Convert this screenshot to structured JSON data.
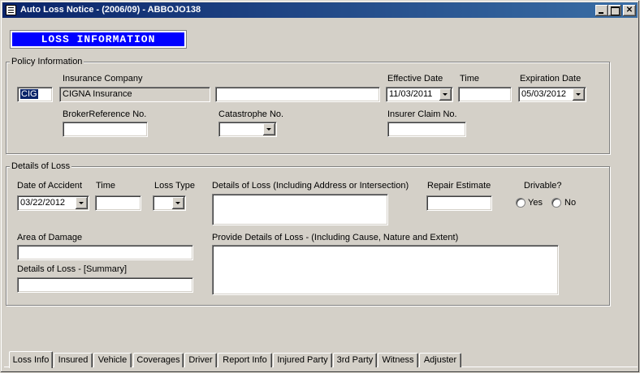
{
  "window": {
    "title": "Auto Loss Notice -  (2006/09) - ABBOJO138"
  },
  "banner": "LOSS INFORMATION",
  "policy": {
    "group_title": "Policy Information",
    "code_value": "CIG",
    "insurance_company_label": "Insurance Company",
    "insurance_company_value": "CIGNA Insurance",
    "company_extra_value": "",
    "effective_date_label": "Effective Date",
    "effective_date_value": "11/03/2011",
    "time_label": "Time",
    "time_value": "",
    "expiration_date_label": "Expiration Date",
    "expiration_date_value": "05/03/2012",
    "broker_ref_label": "BrokerReference No.",
    "broker_ref_value": "",
    "catastrophe_label": "Catastrophe No.",
    "catastrophe_value": "",
    "insurer_claim_label": "Insurer Claim No.",
    "insurer_claim_value": ""
  },
  "loss": {
    "group_title": "Details of Loss",
    "date_of_accident_label": "Date of Accident",
    "date_of_accident_value": "03/22/2012",
    "time_label": "Time",
    "time_value": "",
    "loss_type_label": "Loss Type",
    "loss_type_value": "",
    "details_address_label": "Details of Loss (Including Address or Intersection)",
    "details_address_value": "",
    "repair_estimate_label": "Repair Estimate",
    "repair_estimate_value": "",
    "drivable_label": "Drivable?",
    "yes_label": "Yes",
    "no_label": "No",
    "area_of_damage_label": "Area of Damage",
    "area_of_damage_value": "",
    "summary_label": "Details of Loss - [Summary]",
    "summary_value": "",
    "provide_details_label": "Provide Details of Loss - (Including Cause, Nature and Extent)",
    "provide_details_value": ""
  },
  "tabs": [
    {
      "label": "Loss Info"
    },
    {
      "label": "Insured"
    },
    {
      "label": "Vehicle"
    },
    {
      "label": "Coverages"
    },
    {
      "label": "Driver"
    },
    {
      "label": "Report Info"
    },
    {
      "label": "Injured Party"
    },
    {
      "label": "3rd Party"
    },
    {
      "label": "Witness"
    },
    {
      "label": "Adjuster"
    }
  ]
}
